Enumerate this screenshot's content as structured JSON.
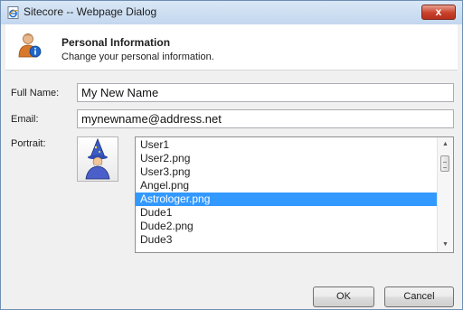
{
  "window": {
    "title": "Sitecore -- Webpage Dialog",
    "close_label": "x"
  },
  "header": {
    "title": "Personal Information",
    "subtitle": "Change your personal information."
  },
  "form": {
    "full_name_label": "Full Name:",
    "full_name_value": "My New Name",
    "email_label": "Email:",
    "email_value": "mynewname@address.net",
    "portrait_label": "Portrait:",
    "portrait_icon": "astrologer-icon",
    "portrait_items": [
      "User1",
      "User2.png",
      "User3.png",
      "Angel.png",
      "Astrologer.png",
      "Dude1",
      "Dude2.png",
      "Dude3"
    ],
    "selected_portrait": "Astrologer.png"
  },
  "buttons": {
    "ok": "OK",
    "cancel": "Cancel"
  },
  "colors": {
    "selection": "#3399ff",
    "close_button": "#c8402a"
  }
}
